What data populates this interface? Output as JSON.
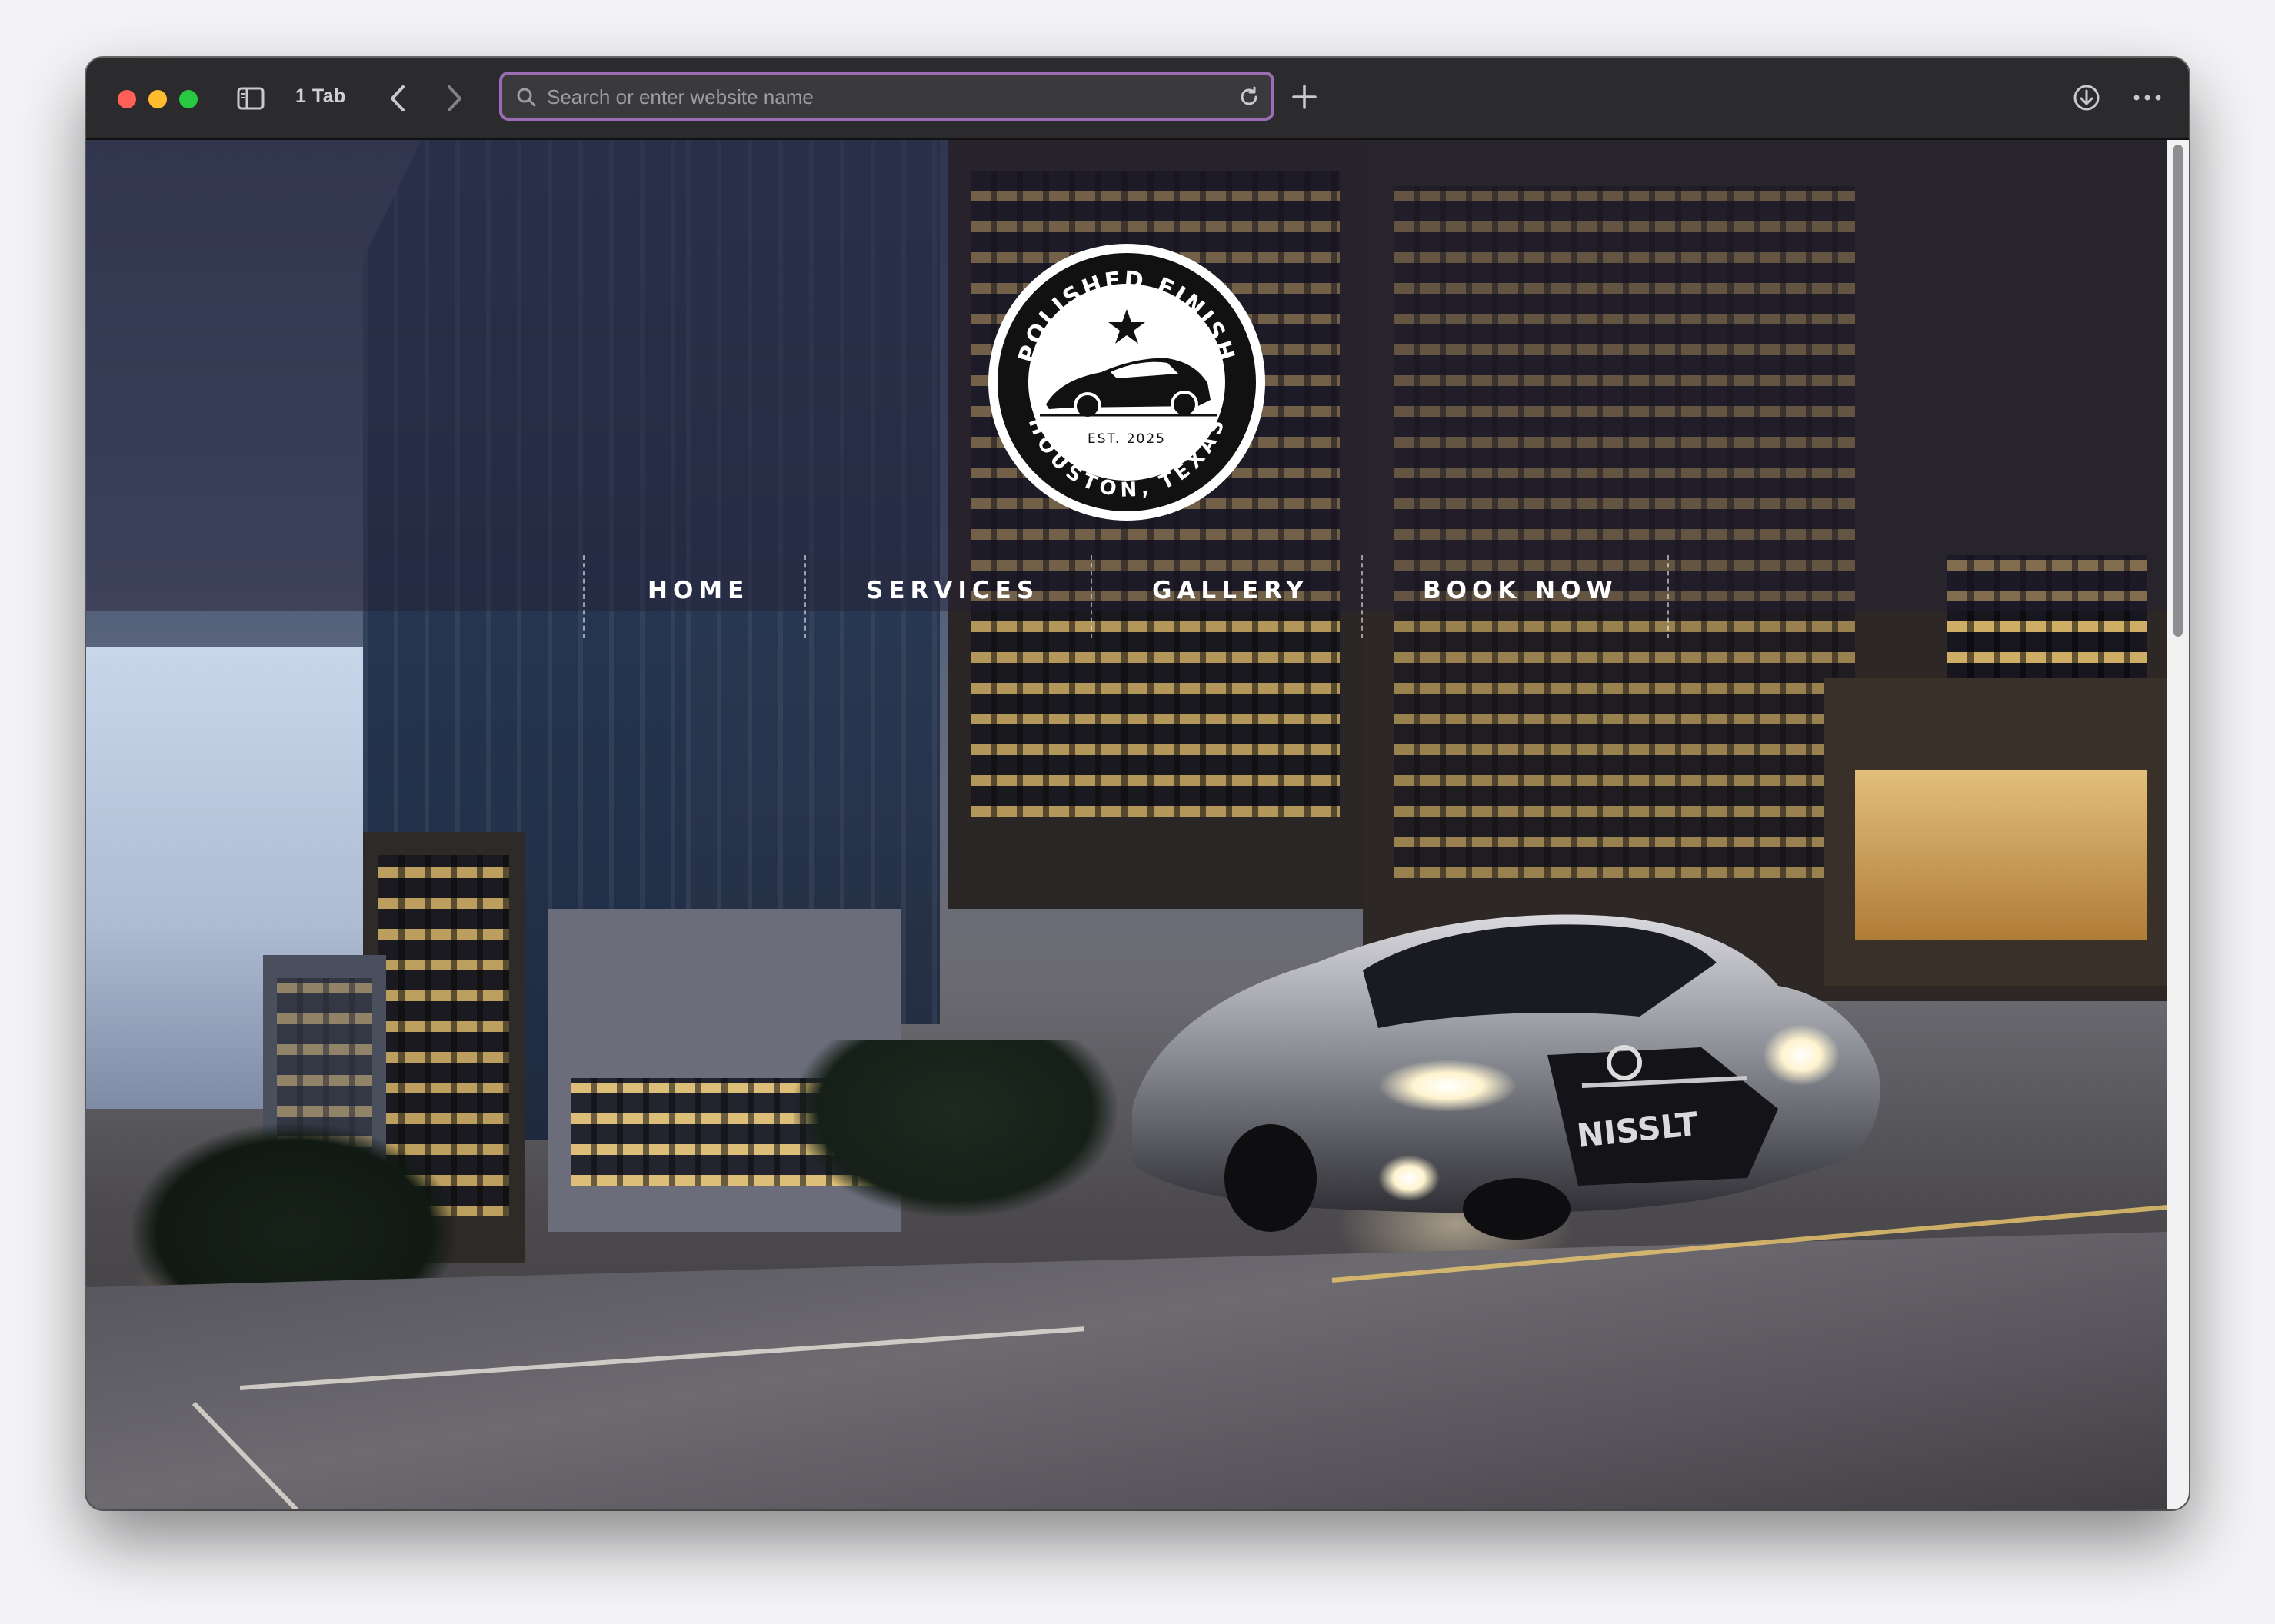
{
  "browser": {
    "tab_count_label": "1 Tab",
    "address_placeholder": "Search or enter website name",
    "address_value": "",
    "accent_color": "#9a6db5"
  },
  "site": {
    "logo": {
      "top_text": "POLISHED FINISH",
      "est_text": "EST. 2025",
      "bottom_text": "HOUSTON, TEXAS"
    },
    "nav": [
      {
        "label": "HOME"
      },
      {
        "label": "SERVICES"
      },
      {
        "label": "GALLERY"
      },
      {
        "label": "BOOK NOW"
      }
    ],
    "hero": {
      "car_badge": "NISSLT"
    }
  },
  "icons": {
    "sidebar": "sidebar-toggle-icon",
    "back": "chevron-left-icon",
    "forward": "chevron-right-icon",
    "search": "search-icon",
    "reload": "reload-icon",
    "new_tab": "plus-icon",
    "download": "download-icon",
    "more": "more-icon"
  }
}
